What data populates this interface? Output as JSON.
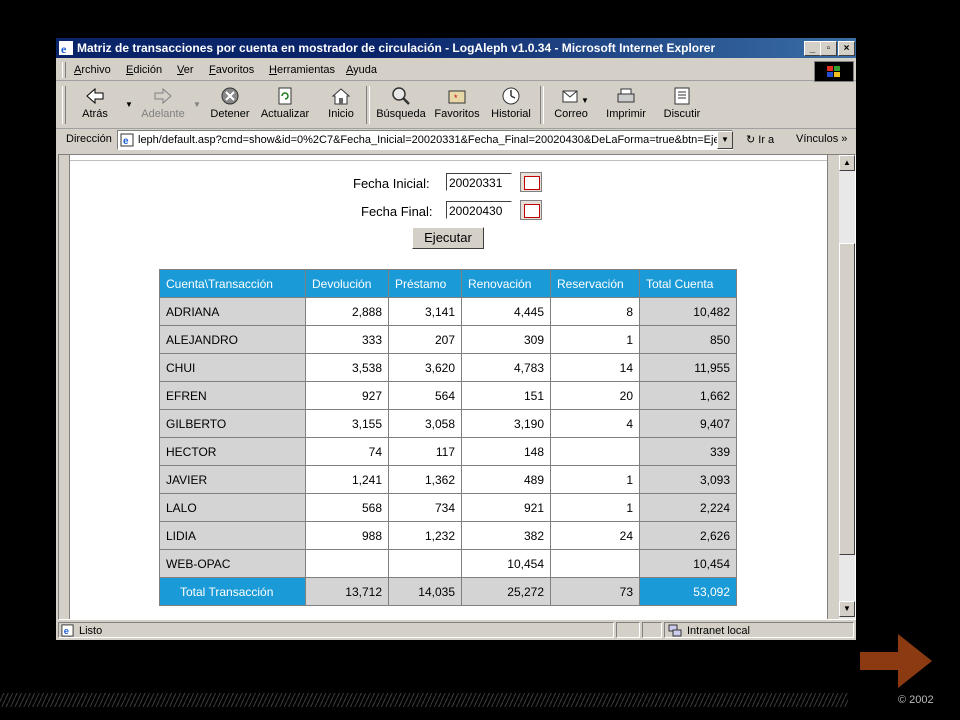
{
  "window": {
    "title": "Matriz de transacciones por cuenta en mostrador de circulación - LogAleph v1.0.34 - Microsoft Internet Explorer"
  },
  "menu": [
    {
      "u": "A",
      "rest": "rchivo"
    },
    {
      "u": "E",
      "rest": "dición"
    },
    {
      "u": "V",
      "rest": "er"
    },
    {
      "u": "F",
      "rest": "avoritos"
    },
    {
      "u": "H",
      "rest": "erramientas"
    },
    {
      "u": "A",
      "rest": "yuda"
    }
  ],
  "toolbar": {
    "back": "Atrás",
    "forward": "Adelante",
    "stop": "Detener",
    "refresh": "Actualizar",
    "home": "Inicio",
    "search": "Búsqueda",
    "favorites": "Favoritos",
    "history": "Historial",
    "mail": "Correo",
    "print": "Imprimir",
    "discuss": "Discutir"
  },
  "address": {
    "label": "Dirección",
    "url": "leph/default.asp?cmd=show&id=0%2C7&Fecha_Inicial=20020331&Fecha_Final=20020430&DeLaForma=true&btn=Ejecutar",
    "go": "Ir a",
    "links": "Vínculos"
  },
  "form": {
    "start_label": "Fecha Inicial:",
    "start_value": "20020331",
    "end_label": "Fecha Final:",
    "end_value": "20020430",
    "run_button": "Ejecutar"
  },
  "table": {
    "headers": [
      "Cuenta\\Transacción",
      "Devolución",
      "Préstamo",
      "Renovación",
      "Reservación",
      "Total Cuenta"
    ],
    "rows": [
      [
        "ADRIANA",
        "2,888",
        "3,141",
        "4,445",
        "8",
        "10,482"
      ],
      [
        "ALEJANDRO",
        "333",
        "207",
        "309",
        "1",
        "850"
      ],
      [
        "CHUI",
        "3,538",
        "3,620",
        "4,783",
        "14",
        "11,955"
      ],
      [
        "EFREN",
        "927",
        "564",
        "151",
        "20",
        "1,662"
      ],
      [
        "GILBERTO",
        "3,155",
        "3,058",
        "3,190",
        "4",
        "9,407"
      ],
      [
        "HECTOR",
        "74",
        "117",
        "148",
        "",
        "339"
      ],
      [
        "JAVIER",
        "1,241",
        "1,362",
        "489",
        "1",
        "3,093"
      ],
      [
        "LALO",
        "568",
        "734",
        "921",
        "1",
        "2,224"
      ],
      [
        "LIDIA",
        "988",
        "1,232",
        "382",
        "24",
        "2,626"
      ],
      [
        "WEB-OPAC",
        "",
        "",
        "10,454",
        "",
        "10,454"
      ]
    ],
    "totals": [
      "Total Transacción",
      "13,712",
      "14,035",
      "25,272",
      "73",
      "53,092"
    ]
  },
  "status": {
    "text": "Listo",
    "zone": "Intranet local"
  },
  "footer": {
    "copyright": "© 2002"
  }
}
